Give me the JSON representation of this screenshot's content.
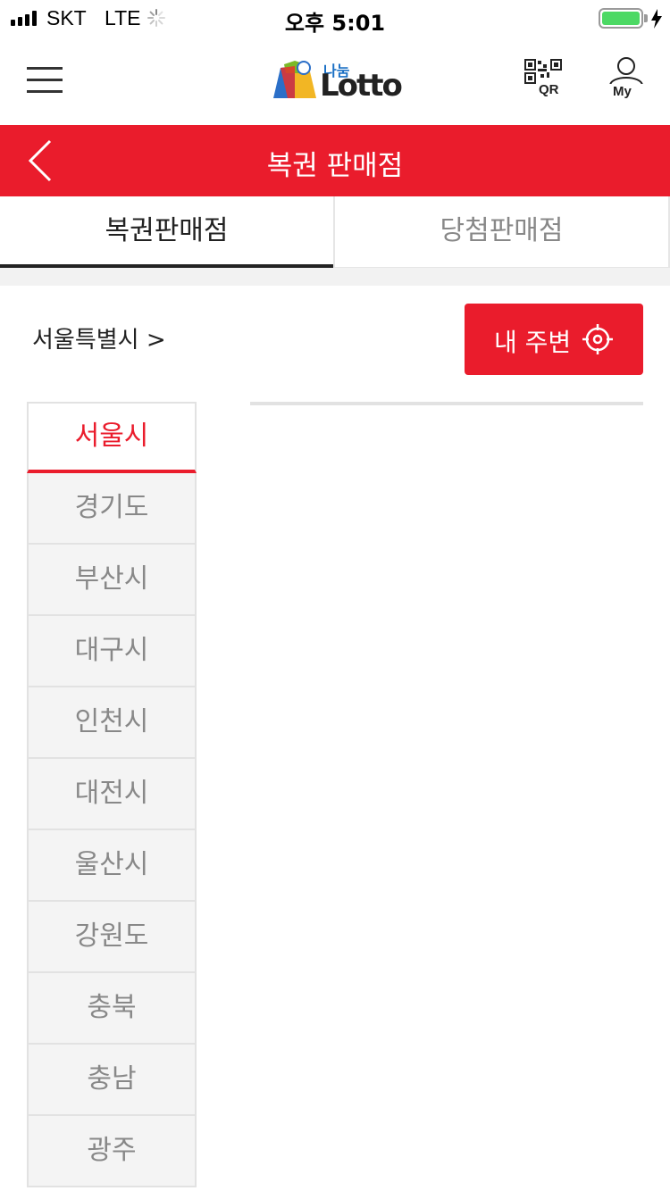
{
  "status_bar": {
    "carrier": "SKT",
    "network": "LTE",
    "time": "오후 5:01",
    "battery_percent": 100
  },
  "header": {
    "logo_small": "나눔",
    "logo_main": "Lotto",
    "qr_label": "QR",
    "my_label": "My",
    "icons": [
      "menu-icon",
      "qr-code-icon",
      "user-icon"
    ]
  },
  "title_bar": {
    "title": "복권 판매점",
    "back_icon": "chevron-left-icon"
  },
  "tabs": [
    {
      "label": "복권판매점",
      "active": true
    },
    {
      "label": "당첨판매점",
      "active": false
    }
  ],
  "location": {
    "text": "서울특별시 >",
    "nearby_label": "내 주변",
    "nearby_icon": "crosshair-icon"
  },
  "regions": [
    {
      "label": "서울시",
      "selected": true
    },
    {
      "label": "경기도",
      "selected": false
    },
    {
      "label": "부산시",
      "selected": false
    },
    {
      "label": "대구시",
      "selected": false
    },
    {
      "label": "인천시",
      "selected": false
    },
    {
      "label": "대전시",
      "selected": false
    },
    {
      "label": "울산시",
      "selected": false
    },
    {
      "label": "강원도",
      "selected": false
    },
    {
      "label": "충북",
      "selected": false
    },
    {
      "label": "충남",
      "selected": false
    },
    {
      "label": "광주",
      "selected": false
    }
  ],
  "colors": {
    "accent": "#ea1c2c",
    "battery": "#4cd964",
    "logo_blue": "#1a6fc4",
    "logo_green": "#7cb928"
  }
}
